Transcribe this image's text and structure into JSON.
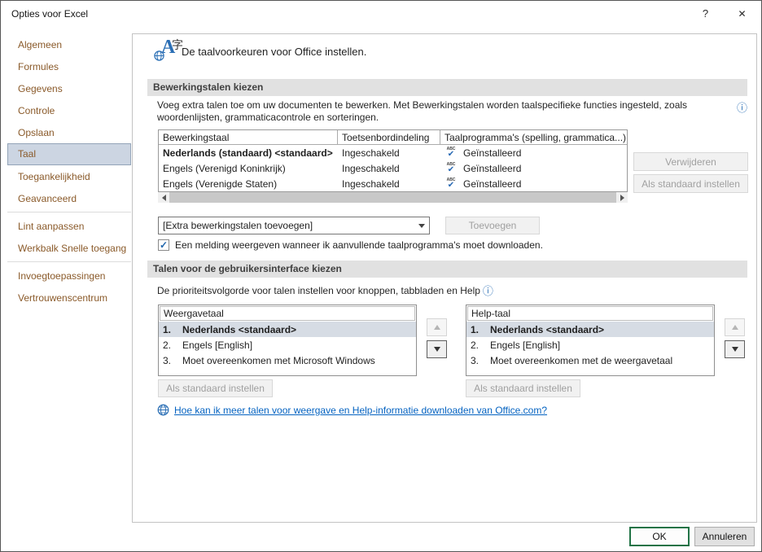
{
  "window": {
    "title": "Opties voor Excel",
    "help": "?",
    "close": "✕"
  },
  "sidebar": {
    "items": [
      {
        "label": "Algemeen"
      },
      {
        "label": "Formules"
      },
      {
        "label": "Gegevens"
      },
      {
        "label": "Controle"
      },
      {
        "label": "Opslaan"
      },
      {
        "label": "Taal",
        "selected": true
      },
      {
        "label": "Toegankelijkheid"
      },
      {
        "label": "Geavanceerd"
      },
      {
        "label": "Lint aanpassen"
      },
      {
        "label": "Werkbalk Snelle toegang"
      },
      {
        "label": "Invoegtoepassingen"
      },
      {
        "label": "Vertrouwenscentrum"
      }
    ]
  },
  "intro": {
    "text": "De taalvoorkeuren voor Office instellen."
  },
  "editing_section": {
    "title": "Bewerkingstalen kiezen",
    "description": "Voeg extra talen toe om uw documenten te bewerken. Met Bewerkingstalen worden taalspecifieke functies ingesteld, zoals woordenlijsten, grammaticacontrole en sorteringen.",
    "table": {
      "columns": [
        "Bewerkingstaal",
        "Toetsenbordindeling",
        "Taalprogramma's (spelling, grammatica...)"
      ],
      "rows": [
        {
          "language": "Nederlands (standaard) <standaard>",
          "keyboard": "Ingeschakeld",
          "proofing": "Geïnstalleerd"
        },
        {
          "language": "Engels (Verenigd Koninkrijk)",
          "keyboard": "Ingeschakeld",
          "proofing": "Geïnstalleerd"
        },
        {
          "language": "Engels (Verenigde Staten)",
          "keyboard": "Ingeschakeld",
          "proofing": "Geïnstalleerd"
        }
      ]
    },
    "remove_button": "Verwijderen",
    "set_default_button": "Als standaard instellen",
    "add_combo_value": "[Extra bewerkingstalen toevoegen]",
    "add_button": "Toevoegen",
    "notify_checkbox_label": "Een melding weergeven wanneer ik aanvullende taalprogramma's moet downloaden.",
    "notify_checkbox_checked": true
  },
  "ui_language_section": {
    "title": "Talen voor de gebruikersinterface kiezen",
    "description": "De prioriteitsvolgorde voor talen instellen voor knoppen, tabbladen en Help",
    "display_list": {
      "header": "Weergavetaal",
      "items": [
        {
          "num": "1.",
          "label": "Nederlands <standaard>"
        },
        {
          "num": "2.",
          "label": "Engels [English]"
        },
        {
          "num": "3.",
          "label": "Moet overeenkomen met Microsoft Windows"
        }
      ],
      "set_default_button": "Als standaard instellen"
    },
    "help_list": {
      "header": "Help-taal",
      "items": [
        {
          "num": "1.",
          "label": "Nederlands <standaard>"
        },
        {
          "num": "2.",
          "label": "Engels [English]"
        },
        {
          "num": "3.",
          "label": "Moet overeenkomen met de weergavetaal"
        }
      ],
      "set_default_button": "Als standaard instellen"
    },
    "download_link": "Hoe kan ik meer talen voor weergave en Help-informatie downloaden van Office.com?"
  },
  "footer": {
    "ok": "OK",
    "cancel": "Annuleren"
  },
  "colors": {
    "excel_green": "#217346",
    "link_blue": "#0563c1",
    "icon_blue": "#2b6fb5",
    "sidebar_text": "#8a5a2a",
    "selected_nav_bg": "#ccd5e2",
    "section_header_bg": "#e1e1e1"
  }
}
